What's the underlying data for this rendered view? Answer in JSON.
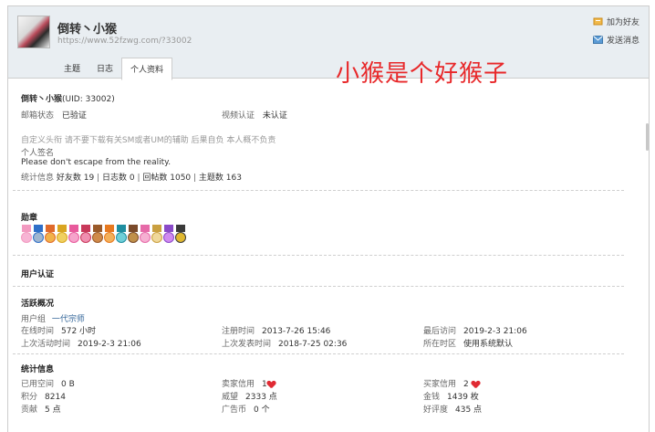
{
  "header": {
    "username": "倒转丶小猴",
    "url": "https://www.52fzwg.com/?33002",
    "add_friend": "加为好友",
    "send_message": "发送消息"
  },
  "tabs": [
    "主题",
    "日志",
    "个人资料"
  ],
  "annotation": "小猴是个好猴子",
  "profile": {
    "name": "倒转丶小猴",
    "uid": "(UID: 33002)",
    "email_label": "邮箱状态",
    "email_value": "已验证",
    "video_label": "视频认证",
    "video_value": "未认证",
    "custom_title": "自定义头衔  请不要下载有关SM或者UM的辅助 后果自负 本人概不负责",
    "signature_label": "个人签名",
    "signature": "Please don't escape from the reality.",
    "stats_label": "统计信息",
    "friends": "好友数 19",
    "logs": "日志数 0",
    "replies": "回帖数 1050",
    "topics": "主题数 163"
  },
  "medals_title": "勋章",
  "medals": [
    "pink-flower",
    "blue-shield",
    "orange-ribbon",
    "gold-ribbon",
    "pink-heart",
    "heart-medal",
    "brown-medal",
    "orange-leaf",
    "teal-medal",
    "book-medal",
    "pink-bow",
    "bow-pendant",
    "purple-gift",
    "gold-cross"
  ],
  "user_auth_title": "用户认证",
  "activity": {
    "title": "活跃概况",
    "group_label": "用户组",
    "group_value": "一代宗师",
    "online_label": "在线时间",
    "online_value": "572 小时",
    "reg_label": "注册时间",
    "reg_value": "2013-7-26 15:46",
    "last_visit_label": "最后访问",
    "last_visit_value": "2019-2-3 21:06",
    "last_active_label": "上次活动时间",
    "last_active_value": "2019-2-3 21:06",
    "last_post_label": "上次发表时间",
    "last_post_value": "2018-7-25 02:36",
    "timezone_label": "所在时区",
    "timezone_value": "使用系统默认"
  },
  "stats": {
    "title": "统计信息",
    "space_label": "已用空间",
    "space_value": "0 B",
    "seller_label": "卖家信用",
    "seller_value": "1",
    "buyer_label": "买家信用",
    "buyer_value": "2",
    "points_label": "积分",
    "points_value": "8214",
    "prestige_label": "威望",
    "prestige_value": "2333 点",
    "money_label": "金钱",
    "money_value": "1439 枚",
    "contrib_label": "贡献",
    "contrib_value": "5 点",
    "adcoin_label": "广告币",
    "adcoin_value": "0 个",
    "goodness_label": "好评度",
    "goodness_value": "435 点"
  },
  "colors": {
    "header_bg": "#e9eef2",
    "annotation": "#e8282a",
    "link": "#336699",
    "heart": "#e02a33"
  }
}
